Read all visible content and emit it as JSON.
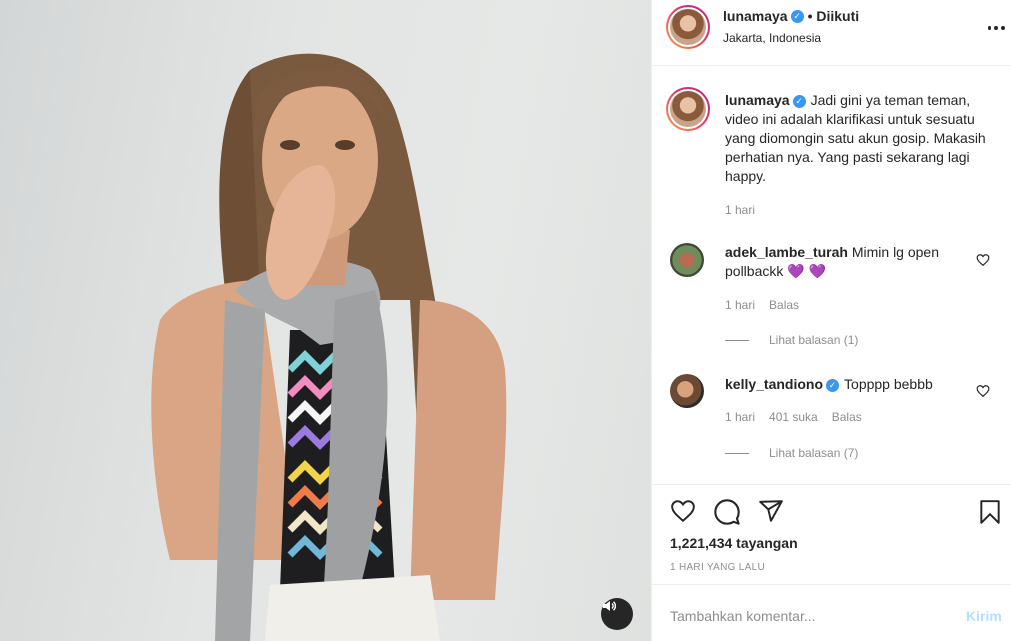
{
  "post": {
    "author": "lunamaya",
    "follow_state": "• Diikuti",
    "location": "Jakarta, Indonesia",
    "verified_mark": "✓"
  },
  "caption": {
    "username": "lunamaya",
    "text": "Jadi gini ya teman teman, video ini adalah klarifikasi untuk sesuatu yang diomongin satu akun gosip. Makasih perhatian nya. Yang pasti sekarang lagi happy.",
    "time": "1 hari"
  },
  "comments": [
    {
      "username": "adek_lambe_turah",
      "text": "Mimin lg open pollbackk",
      "emoji": "💜 💜",
      "time": "1 hari",
      "reply_label": "Balas",
      "view_replies": "Lihat balasan (1)"
    },
    {
      "username": "kelly_tandiono",
      "text": "Topppp bebbb",
      "time": "1 hari",
      "likes": "401 suka",
      "reply_label": "Balas",
      "view_replies": "Lihat balasan (7)"
    }
  ],
  "stats": {
    "views": "1,221,434 tayangan",
    "time_ago": "1 HARI YANG LALU"
  },
  "add_comment": {
    "placeholder": "Tambahkan komentar...",
    "post_label": "Kirim"
  },
  "colors": {
    "verified": "#3897f0",
    "muted_text": "#8e8e8e",
    "post_button_disabled": "#b2dffc",
    "story_ring": "#e1306c",
    "heart_emoji": "#8a6ee6"
  },
  "icons": {
    "like": "heart-icon",
    "comment": "comment-icon",
    "share": "paper-plane-icon",
    "save": "bookmark-icon",
    "mute": "speaker-icon",
    "more": "more-icon"
  }
}
